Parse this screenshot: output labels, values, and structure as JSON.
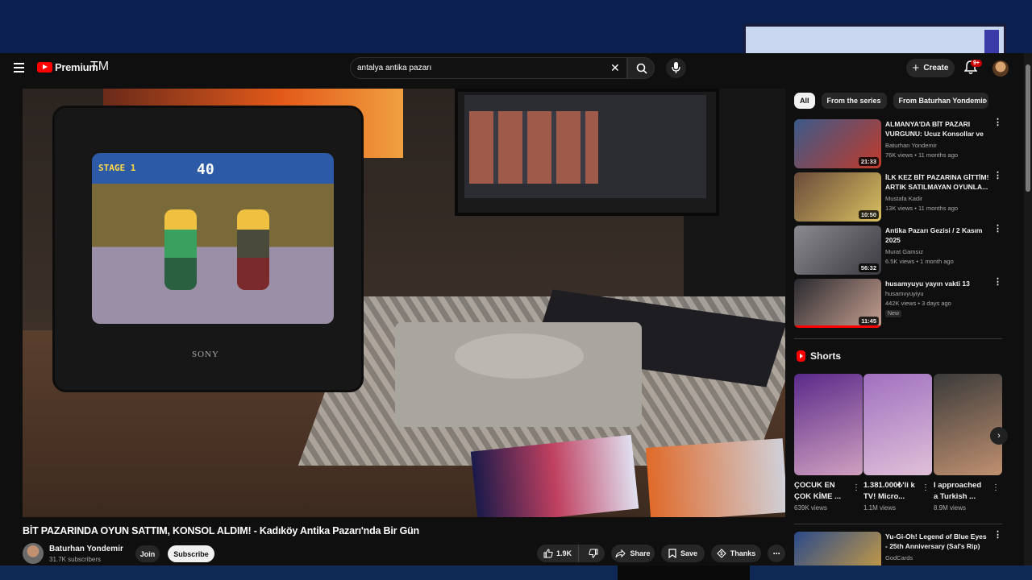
{
  "app": {
    "logo_text": "Premium",
    "logo_tm": "TM"
  },
  "search": {
    "query": "antalya antika pazarı"
  },
  "header": {
    "create_label": "Create",
    "notification_count": "9+"
  },
  "video": {
    "title": "BİT PAZARINDA OYUN SATTIM, KONSOL ALDIM! - Kadıköy Antika Pazarı'nda Bir Gün",
    "hud_left": "STAGE 1",
    "hud_timer": "40",
    "tv_brand": "SONY"
  },
  "channel": {
    "name": "Baturhan Yondemir",
    "subscribers": "31.7K subscribers",
    "join_label": "Join",
    "subscribe_label": "Subscribe"
  },
  "actions": {
    "likes": "1.9K",
    "share_label": "Share",
    "save_label": "Save",
    "thanks_label": "Thanks"
  },
  "chips": [
    "All",
    "From the series",
    "From Baturhan Yondemir"
  ],
  "recommendations": [
    {
      "title": "ALMANYA'DA BİT PAZARI VURGUNU: Ucuz Konsollar ve ...",
      "channel": "Baturhan Yondemir",
      "meta": "76K views • 11 months ago",
      "duration": "21:33",
      "colors": [
        "#3a5a8a",
        "#c23a2a"
      ]
    },
    {
      "title": "İLK KEZ BİT PAZARINA GİTTİM! ARTIK SATILMAYAN OYUNLA...",
      "channel": "Mustafa Kadir",
      "meta": "13K views • 11 months ago",
      "duration": "10:50",
      "colors": [
        "#6a4a3a",
        "#d8c060"
      ]
    },
    {
      "title": "Antika Pazarı Gezisi / 2 Kasım 2025",
      "channel": "Murat Gamsız",
      "meta": "6.5K views • 1 month ago",
      "duration": "56:32",
      "colors": [
        "#8a8a90",
        "#3a3a40"
      ]
    },
    {
      "title": "husamyuyu yayın vakti 13",
      "channel": "husamvyuyiyu",
      "meta": "442K views • 3 days ago",
      "badge": "New",
      "duration": "11:45",
      "colors": [
        "#2a2a30",
        "#c8a090"
      ]
    }
  ],
  "shorts": {
    "heading": "Shorts",
    "items": [
      {
        "title": "ÇOCUK EN ÇOK KİME ...",
        "views": "639K views",
        "colors": [
          "#5a2a8a",
          "#d0a0c0"
        ]
      },
      {
        "title": "1.381.000₺'li k TV! Micro...",
        "views": "1.1M views",
        "colors": [
          "#a070c0",
          "#e0c0d8"
        ]
      },
      {
        "title": "I approached a Turkish ...",
        "views": "8.9M views",
        "colors": [
          "#3a3a3a",
          "#c09070"
        ]
      }
    ]
  },
  "last_rec": {
    "title": "Yu-Gi-Oh! Legend of Blue Eyes - 25th Anniversary (Sal's Rip)",
    "channel": "GodCards",
    "colors": [
      "#2a4a8a",
      "#d0a040"
    ]
  }
}
